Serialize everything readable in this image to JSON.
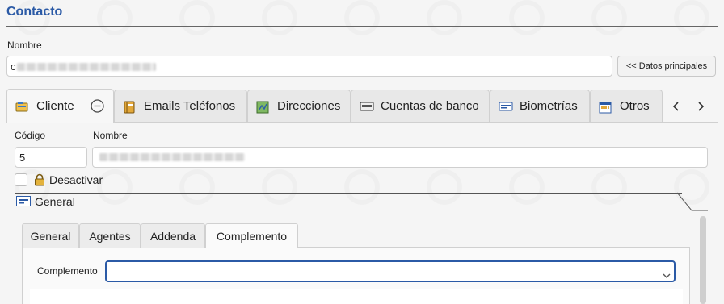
{
  "header": {
    "title": "Contacto"
  },
  "contact": {
    "name_label": "Nombre",
    "name_prefix": "c",
    "main_data_button": "<< Datos principales"
  },
  "tabs": [
    {
      "label": "Cliente",
      "icon": "client-card-icon"
    },
    {
      "label": "Emails Teléfonos",
      "icon": "address-book-icon"
    },
    {
      "label": "Direcciones",
      "icon": "map-icon"
    },
    {
      "label": "Cuentas de banco",
      "icon": "bank-card-icon"
    },
    {
      "label": "Biometrías",
      "icon": "id-card-icon"
    },
    {
      "label": "Otros",
      "icon": "calendar-icon"
    }
  ],
  "client": {
    "code_label": "Código",
    "code_value": "5",
    "name_label": "Nombre",
    "deactivate_label": "Desactivar",
    "section_title": "General"
  },
  "subtabs": [
    {
      "label": "General"
    },
    {
      "label": "Agentes"
    },
    {
      "label": "Addenda"
    },
    {
      "label": "Complemento"
    }
  ],
  "complemento": {
    "label": "Complemento",
    "value": ""
  },
  "colors": {
    "accent": "#2b5aa6",
    "focus": "#2b5aa6"
  }
}
